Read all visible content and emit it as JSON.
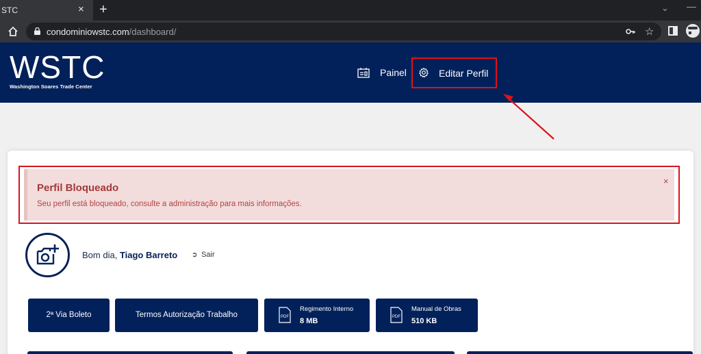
{
  "browser": {
    "tab_title": "STC",
    "tab_close": "×",
    "new_tab": "+",
    "url_host": "condominiowstc.com",
    "url_path": "/dashboard/"
  },
  "site": {
    "logo_text": "WSTC",
    "logo_subtitle": "Washington Soares Trade Center",
    "nav": {
      "painel": "Painel",
      "editar_perfil": "Editar Perfil"
    }
  },
  "alert": {
    "title": "Perfil Bloqueado",
    "message": "Seu perfil está bloqueado, consulte a administração para mais informações.",
    "close": "×"
  },
  "user": {
    "greeting": "Bom dia,",
    "name": "Tiago Barreto",
    "logout": "Sair"
  },
  "buttons": [
    {
      "label": "2ª Via Boleto"
    },
    {
      "label": "Termos Autorização Trabalho"
    },
    {
      "title": "Regimento Interno",
      "size": "8 MB"
    },
    {
      "title": "Manual de Obras",
      "size": "510 KB"
    }
  ],
  "colors": {
    "brand_navy": "#02215a",
    "annotation_red": "#e0111a",
    "alert_bg": "#f3dcdc",
    "alert_text": "#a23a3a"
  }
}
